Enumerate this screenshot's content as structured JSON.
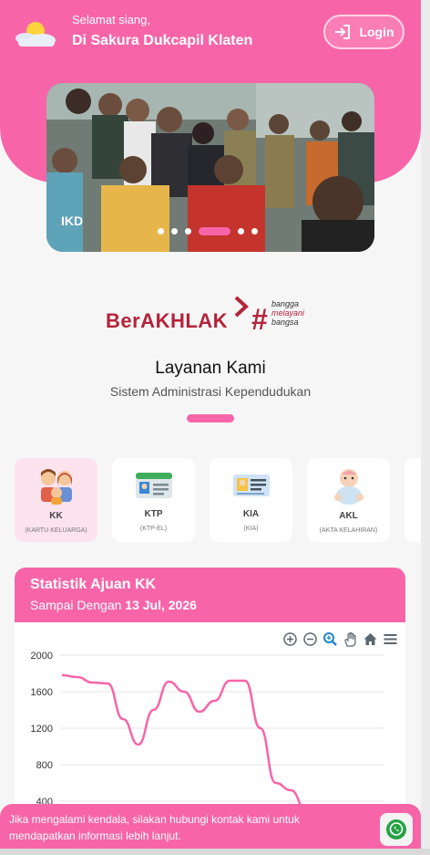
{
  "header": {
    "greeting": "Selamat siang,",
    "location": "Di Sakura Dukcapil Klaten",
    "login_label": "Login",
    "icon": "sun-cloud-icon"
  },
  "carousel": {
    "caption": "IKD",
    "slide_count": 7,
    "active_index": 3
  },
  "brand": {
    "logo_main": "BerAKHLAK",
    "logo_hash": "#",
    "tagline": [
      "bangga",
      "melayani",
      "bangsa"
    ]
  },
  "services_section": {
    "title": "Layanan Kami",
    "subtitle": "Sistem Administrasi Kependudukan",
    "items": [
      {
        "label": "KK",
        "sub": "(KARTU KELUARGA)",
        "icon": "family-icon"
      },
      {
        "label": "KTP",
        "sub": "(KTP-EL)",
        "icon": "id-card-icon"
      },
      {
        "label": "KIA",
        "sub": "(KIA)",
        "icon": "child-id-card-icon"
      },
      {
        "label": "AKL",
        "sub": "(AKTA KELAHIRAN)",
        "icon": "baby-icon"
      }
    ]
  },
  "stats": {
    "title": "Statistik Ajuan KK",
    "subtitle_prefix": "Sampai Dengan",
    "date": "13 Jul, 2026",
    "toolbar": [
      "zoom-in-icon",
      "zoom-out-icon",
      "search-zoom-icon",
      "pan-hand-icon",
      "home-icon",
      "menu-icon"
    ]
  },
  "chart_data": {
    "type": "line",
    "title": "",
    "xlabel": "",
    "ylabel": "",
    "ylim": [
      0,
      2000
    ],
    "yticks": [
      400,
      800,
      1200,
      1600,
      2000
    ],
    "series": [
      {
        "values": [
          1780,
          1760,
          1700,
          1690,
          1300,
          1020,
          1400,
          1710,
          1600,
          1380,
          1500,
          1720,
          1720,
          1200,
          600,
          520,
          300
        ]
      }
    ],
    "colors": {
      "line": "#f765a8",
      "grid": "#e5e5e5"
    }
  },
  "footer": {
    "message": "Jika mengalami kendala, silakan hubungi kontak kami untuk mendapatkan informasi lebih lanjut.",
    "icon": "whatsapp-icon"
  },
  "colors": {
    "brand": "#f765a8",
    "brand_text": "#b3243a"
  }
}
